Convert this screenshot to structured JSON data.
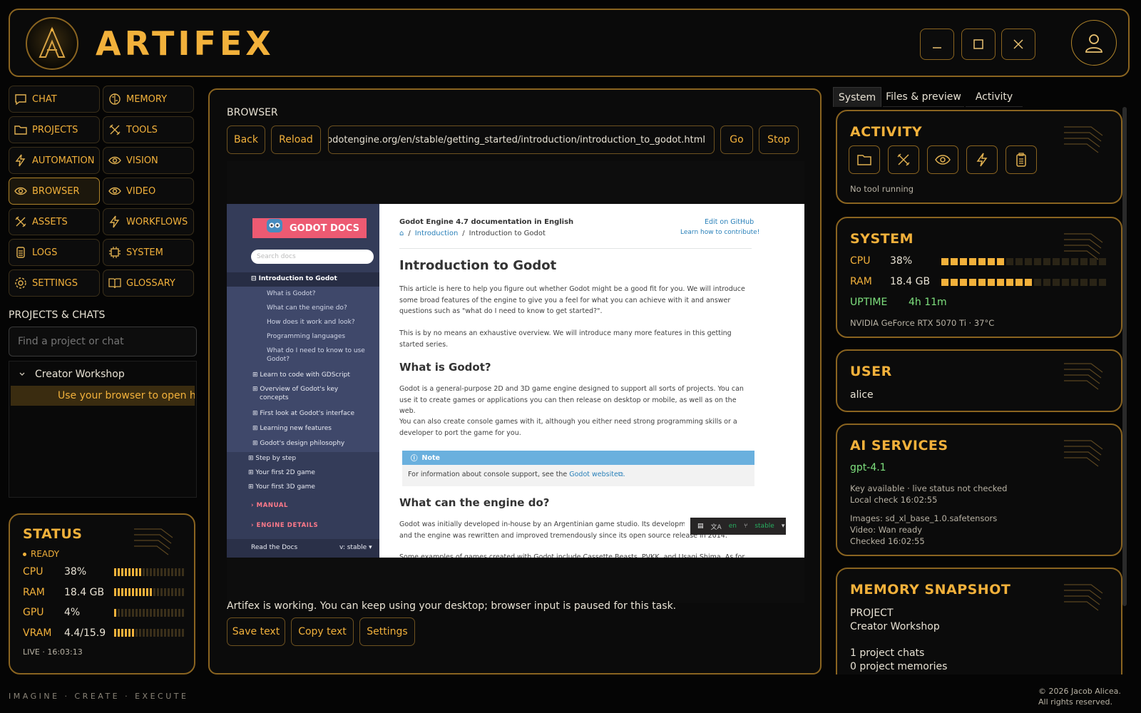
{
  "app": {
    "title": "ARTIFEX"
  },
  "nav": [
    {
      "label": "CHAT",
      "icon": "chat-icon"
    },
    {
      "label": "MEMORY",
      "icon": "brain-icon"
    },
    {
      "label": "PROJECTS",
      "icon": "folder-icon"
    },
    {
      "label": "TOOLS",
      "icon": "tools-icon"
    },
    {
      "label": "AUTOMATION",
      "icon": "bolt-icon"
    },
    {
      "label": "VISION",
      "icon": "eye-icon"
    },
    {
      "label": "BROWSER",
      "icon": "eye-icon",
      "active": true
    },
    {
      "label": "VIDEO",
      "icon": "eye-icon"
    },
    {
      "label": "ASSETS",
      "icon": "tools-icon"
    },
    {
      "label": "WORKFLOWS",
      "icon": "bolt-icon"
    },
    {
      "label": "LOGS",
      "icon": "clipboard-icon"
    },
    {
      "label": "SYSTEM",
      "icon": "chip-icon"
    },
    {
      "label": "SETTINGS",
      "icon": "gear-icon"
    },
    {
      "label": "GLOSSARY",
      "icon": "book-icon"
    }
  ],
  "projects": {
    "label": "PROJECTS & CHATS",
    "search_placeholder": "Find a project or chat",
    "group": "Creator Workshop",
    "item": "Use your browser to open h..."
  },
  "status": {
    "title": "STATUS",
    "state": "READY",
    "rows": [
      {
        "key": "CPU",
        "value": "38%",
        "level": 0.38
      },
      {
        "key": "RAM",
        "value": "18.4 GB",
        "level": 0.55
      },
      {
        "key": "GPU",
        "value": "4%",
        "level": 0.04
      },
      {
        "key": "VRAM",
        "value": "4.4/15.9",
        "level": 0.28
      }
    ],
    "live": "LIVE · 16:03:13"
  },
  "browser": {
    "label": "BROWSER",
    "back": "Back",
    "reload": "Reload",
    "url": ":s.godotengine.org/en/stable/getting_started/introduction/introduction_to_godot.html",
    "go": "Go",
    "stop": "Stop",
    "working_msg": "Artifex is working. You can keep using your desktop; browser input is paused for this task.",
    "save_text": "Save text",
    "copy_text": "Copy text",
    "settings": "Settings"
  },
  "webpage": {
    "logo": "GODOT DOCS",
    "search": "Search docs",
    "sidebar": [
      {
        "text": "⊟ Introduction to Godot",
        "kind": "cur"
      },
      {
        "text": "What is Godot?",
        "kind": "sub"
      },
      {
        "text": "What can the engine do?",
        "kind": "sub"
      },
      {
        "text": "How does it work and look?",
        "kind": "sub"
      },
      {
        "text": "Programming languages",
        "kind": "sub"
      },
      {
        "text": "What do I need to know to use",
        "kind": "sub"
      },
      {
        "text": "Godot?",
        "kind": "sub"
      },
      {
        "text": "⊞ Learn to code with GDScript",
        "kind": "item"
      },
      {
        "text": "⊞ Overview of Godot's key",
        "kind": "item"
      },
      {
        "text": "concepts",
        "kind": "item"
      },
      {
        "text": "⊞ First look at Godot's interface",
        "kind": "item"
      },
      {
        "text": "⊞ Learning new features",
        "kind": "item"
      },
      {
        "text": "⊞ Godot's design philosophy",
        "kind": "item"
      },
      {
        "text": "⊞ Step by step",
        "kind": "top"
      },
      {
        "text": "⊞ Your first 2D game",
        "kind": "top"
      },
      {
        "text": "⊞ Your first 3D game",
        "kind": "top"
      },
      {
        "text": "› MANUAL",
        "kind": "cap"
      },
      {
        "text": "› ENGINE DETAILS",
        "kind": "cap"
      }
    ],
    "read_the_docs": "Read the Docs",
    "version_select": "v: stable ▾",
    "doc_header": "Godot Engine 4.7 documentation in English",
    "edit_link": "Edit on GitHub",
    "contribute_link": "Learn how to contribute!",
    "breadcrumb_1": "Introduction",
    "breadcrumb_2": "Introduction to Godot",
    "h1": "Introduction to Godot",
    "p1": "This article is here to help you figure out whether Godot might be a good fit for you. We will introduce some broad features of the engine to give you a feel for what you can achieve with it and answer questions such as \"what do I need to know to get started?\".",
    "p2": "This is by no means an exhaustive overview. We will introduce many more features in this getting started series.",
    "h2a": "What is Godot?",
    "p3": "Godot is a general-purpose 2D and 3D game engine designed to support all sorts of projects. You can use it to create games or applications you can then release on desktop or mobile, as well as on the web.",
    "p4": "You can also create console games with it, although you either need strong programming skills or a developer to port the game for you.",
    "note_title": "Note",
    "note_text": "For information about console support, see the ",
    "note_link": "Godot website⧉.",
    "h2b": "What can the engine do?",
    "p5": "Godot was initially developed in-house by an Argentinian game studio. Its development",
    "p5b": "and the engine was rewritten and improved tremendously since its open source release in 2014.",
    "p6": "Some examples of games created with Godot include Cassette Beasts, PVKK, and Usagi Shima. As for",
    "lang": "en",
    "branch": "stable"
  },
  "right_tabs": [
    "System",
    "Files & preview",
    "Activity"
  ],
  "activity": {
    "title": "ACTIVITY",
    "status": "No tool running"
  },
  "system": {
    "title": "SYSTEM",
    "cpu_label": "CPU",
    "cpu": "38%",
    "cpu_level": 0.38,
    "ram_label": "RAM",
    "ram": "18.4 GB",
    "ram_level": 0.55,
    "uptime_label": "UPTIME",
    "uptime": "4h 11m",
    "gpu": "NVIDIA GeForce RTX 5070 Ti · 37°C"
  },
  "user": {
    "title": "USER",
    "name": "alice"
  },
  "ai": {
    "title": "AI SERVICES",
    "model": "gpt-4.1",
    "line1": "Key available · live status not checked",
    "line2": "Local check 16:02:55",
    "line3": "Images: sd_xl_base_1.0.safetensors",
    "line4": "Video: Wan ready",
    "line5": "Checked 16:02:55"
  },
  "memory": {
    "title": "MEMORY SNAPSHOT",
    "label": "PROJECT",
    "project": "Creator Workshop",
    "chats": "1 project chats",
    "memories": "0 project memories"
  },
  "footer": {
    "tagline": "IMAGINE · CREATE · EXECUTE",
    "copy1": "© 2026 Jacob Alicea.",
    "copy2": "All rights reserved."
  },
  "colors": {
    "accent": "#f2b13b",
    "border": "#8a6420",
    "bg": "#050505",
    "ok": "#7ee07e"
  }
}
